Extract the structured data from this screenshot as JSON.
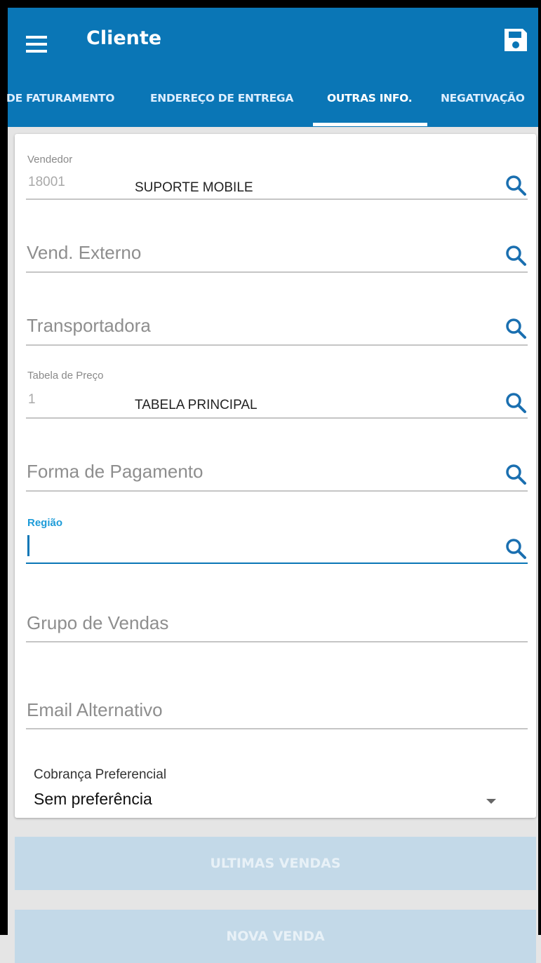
{
  "appbar": {
    "title": "Cliente",
    "menu_icon": "menu-icon",
    "save_icon": "save-icon",
    "color": "#0a76b6"
  },
  "tabs": [
    {
      "label": "DE FATURAMENTO",
      "active": false
    },
    {
      "label": "ENDEREÇO DE ENTREGA",
      "active": false
    },
    {
      "label": "OUTRAS INFO.",
      "active": true
    },
    {
      "label": "NEGATIVAÇÃO",
      "active": false
    }
  ],
  "form": {
    "vendedor": {
      "label": "Vendedor",
      "code": "18001",
      "description": "SUPORTE MOBILE"
    },
    "vend_externo": {
      "placeholder": "Vend. Externo"
    },
    "transportadora": {
      "placeholder": "Transportadora"
    },
    "tabela_preco": {
      "label": "Tabela de Preço",
      "code": "1",
      "description": "TABELA PRINCIPAL"
    },
    "forma_pagamento": {
      "placeholder": "Forma de Pagamento"
    },
    "regiao": {
      "label": "Região",
      "value": ""
    },
    "grupo_vendas": {
      "placeholder": "Grupo de Vendas"
    },
    "email_alternativo": {
      "placeholder": "Email Alternativo"
    },
    "cobranca": {
      "label": "Cobrança Preferencial",
      "value": "Sem preferência"
    }
  },
  "buttons": {
    "ultimas_vendas": "ULTIMAS VENDAS",
    "nova_venda": "NOVA VENDA"
  }
}
